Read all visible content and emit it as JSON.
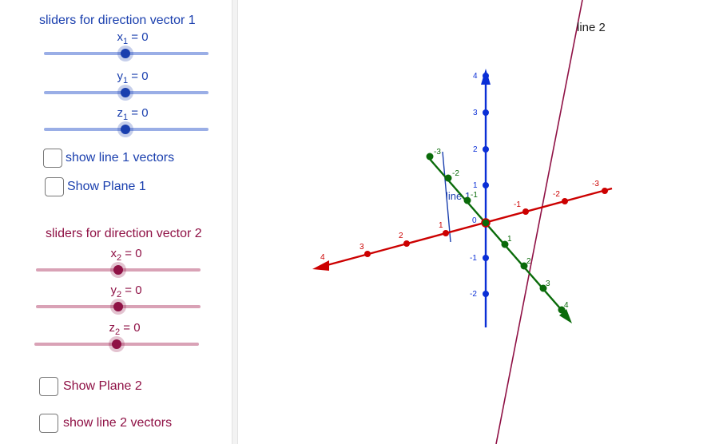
{
  "panel": {
    "group1": {
      "heading": "sliders for direction vector 1",
      "color": "#1a3fae",
      "sliders": [
        {
          "var": "x",
          "sub": "1",
          "eq": " = 0",
          "value": 0,
          "min": -5,
          "max": 5
        },
        {
          "var": "y",
          "sub": "1",
          "eq": " = 0",
          "value": 0,
          "min": -5,
          "max": 5
        },
        {
          "var": "z",
          "sub": "1",
          "eq": " = 0",
          "value": 0,
          "min": -5,
          "max": 5
        }
      ],
      "checkboxes": [
        {
          "label": "show line 1 vectors",
          "checked": false
        },
        {
          "label": "Show Plane 1",
          "checked": false
        }
      ]
    },
    "group2": {
      "heading": "sliders for direction vector 2",
      "color": "#8f1145",
      "sliders": [
        {
          "var": "x",
          "sub": "2",
          "eq": " = 0",
          "value": 0,
          "min": -5,
          "max": 5
        },
        {
          "var": "y",
          "sub": "2",
          "eq": " = 0",
          "value": 0,
          "min": -5,
          "max": 5
        },
        {
          "var": "z",
          "sub": "2",
          "eq": " = 0",
          "value": 0,
          "min": -5,
          "max": 5
        }
      ],
      "checkboxes": [
        {
          "label": "Show Plane 2",
          "checked": false
        },
        {
          "label": "show line 2 vectors",
          "checked": false
        }
      ]
    }
  },
  "graph": {
    "line1_label": "line 1",
    "line2_label": "line 2",
    "origin_label": "0",
    "z_ticks": [
      "4",
      "3",
      "2",
      "1",
      "-1",
      "-2"
    ],
    "x_ticks": [
      "4",
      "3",
      "2",
      "1",
      "-1",
      "-2",
      "-3"
    ],
    "y_ticks": [
      "-3",
      "-2",
      "-1",
      "1",
      "2",
      "3",
      "4"
    ],
    "colors": {
      "x_axis": "#cc0000",
      "y_axis": "#0a6b0a",
      "z_axis": "#0a2fd6",
      "line1": "#1a3fae",
      "line2": "#8f1145"
    }
  }
}
